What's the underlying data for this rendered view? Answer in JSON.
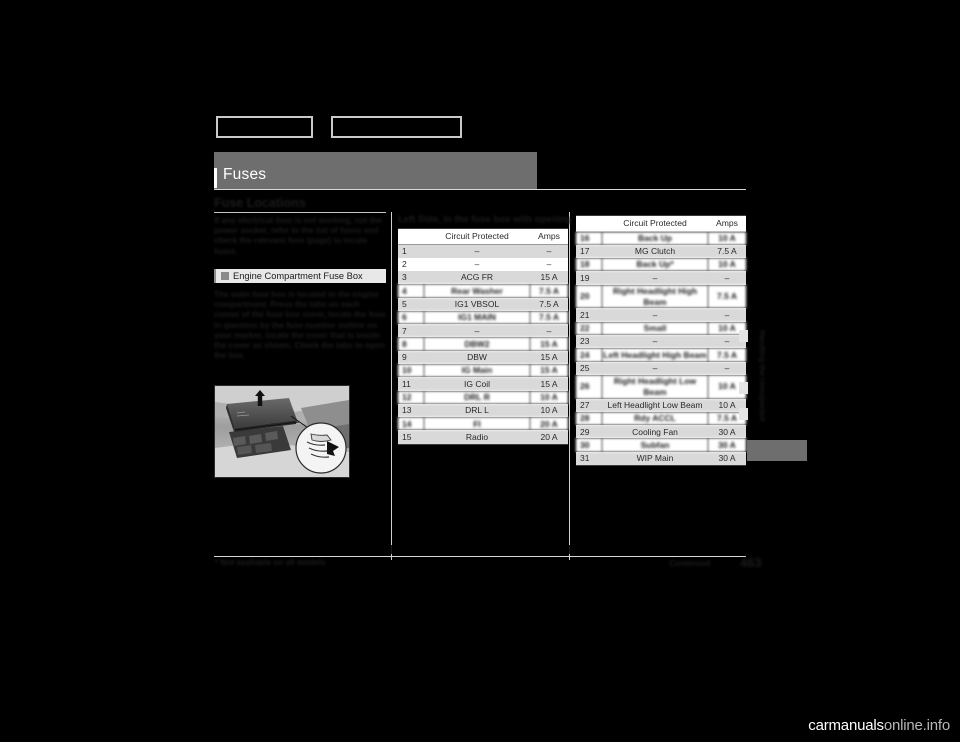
{
  "viewer": {
    "background_color": "#000000",
    "watermark": "carmanualsonline.info",
    "watermark_prefix": "carmanuals",
    "watermark_suffix": "online.info"
  },
  "topnav": {
    "prev_label": "",
    "next_label": ""
  },
  "chapter": {
    "title": "Fuses",
    "bar_color": "#6e6e6e"
  },
  "section": {
    "heading": "Fuse Locations"
  },
  "left_column": {
    "intro_paragraph": "If any electrical item is not working, not the power socket, refer to the list of fuses and check the relevant fuse (page) to locate fuses.",
    "subsection": {
      "swatch_color": "#8a8a8a",
      "title": "Engine Compartment Fuse Box"
    },
    "body_paragraph": "The main fuse box is located in the engine compartment. Press the tabs on each corner of the fuse box cover, locate the fuse in question by the fuse number outline on your marker, locate the cover that is inside the cover as shown. Check the tabs to open the box.",
    "illustration_name": "engine-compartment-fuse-box-photo"
  },
  "table_middle": {
    "caption": "Left Side, in the fuse box with opening",
    "headers": [
      "",
      "Circuit Protected",
      "Amps"
    ],
    "rows": [
      {
        "no": "1",
        "circuit": "–",
        "amps": "–",
        "shade": true,
        "obscured": false
      },
      {
        "no": "2",
        "circuit": "–",
        "amps": "–",
        "shade": false,
        "obscured": false
      },
      {
        "no": "3",
        "circuit": "ACG FR",
        "amps": "15 A",
        "shade": true,
        "obscured": false
      },
      {
        "no": "4",
        "circuit": "Rear Washer",
        "amps": "7.5 A",
        "shade": false,
        "obscured": true
      },
      {
        "no": "5",
        "circuit": "IG1 VBSOL",
        "amps": "7.5 A",
        "shade": true,
        "obscured": false
      },
      {
        "no": "6",
        "circuit": "IG1 MAIN",
        "amps": "7.5 A",
        "shade": false,
        "obscured": true
      },
      {
        "no": "7",
        "circuit": "–",
        "amps": "–",
        "shade": true,
        "obscured": false
      },
      {
        "no": "8",
        "circuit": "DBW2",
        "amps": "15 A",
        "shade": false,
        "obscured": true
      },
      {
        "no": "9",
        "circuit": "DBW",
        "amps": "15 A",
        "shade": true,
        "obscured": false
      },
      {
        "no": "10",
        "circuit": "IG Main",
        "amps": "15 A",
        "shade": false,
        "obscured": true
      },
      {
        "no": "11",
        "circuit": "IG Coil",
        "amps": "15 A",
        "shade": true,
        "obscured": false
      },
      {
        "no": "12",
        "circuit": "DRL R",
        "amps": "10 A",
        "shade": false,
        "obscured": true
      },
      {
        "no": "13",
        "circuit": "DRL L",
        "amps": "10 A",
        "shade": true,
        "obscured": false
      },
      {
        "no": "14",
        "circuit": "FI",
        "amps": "20 A",
        "shade": false,
        "obscured": true
      },
      {
        "no": "15",
        "circuit": "Radio",
        "amps": "20 A",
        "shade": true,
        "obscured": false
      }
    ]
  },
  "table_right": {
    "headers": [
      "",
      "Circuit Protected",
      "Amps"
    ],
    "rows": [
      {
        "no": "16",
        "circuit": "Back Up",
        "amps": "10 A",
        "shade": false,
        "obscured": true
      },
      {
        "no": "17",
        "circuit": "MG Clutch",
        "amps": "7.5 A",
        "shade": true,
        "obscured": false
      },
      {
        "no": "18",
        "circuit": "Back Up*",
        "amps": "10 A",
        "shade": false,
        "obscured": true
      },
      {
        "no": "19",
        "circuit": "–",
        "amps": "–",
        "shade": true,
        "obscured": false
      },
      {
        "no": "20",
        "circuit": "Right Headlight High Beam",
        "amps": "7.5 A",
        "shade": false,
        "obscured": true
      },
      {
        "no": "21",
        "circuit": "–",
        "amps": "–",
        "shade": true,
        "obscured": false
      },
      {
        "no": "22",
        "circuit": "Small",
        "amps": "10 A",
        "shade": false,
        "obscured": true
      },
      {
        "no": "23",
        "circuit": "–",
        "amps": "–",
        "shade": true,
        "obscured": false
      },
      {
        "no": "24",
        "circuit": "Left Headlight High Beam",
        "amps": "7.5 A",
        "shade": false,
        "obscured": true
      },
      {
        "no": "25",
        "circuit": "–",
        "amps": "–",
        "shade": true,
        "obscured": false
      },
      {
        "no": "26",
        "circuit": "Right Headlight Low Beam",
        "amps": "10 A",
        "shade": false,
        "obscured": true
      },
      {
        "no": "27",
        "circuit": "Left Headlight Low Beam",
        "amps": "10 A",
        "shade": true,
        "obscured": false
      },
      {
        "no": "28",
        "circuit": "Rdy ACCL",
        "amps": "7.5 A",
        "shade": false,
        "obscured": true
      },
      {
        "no": "29",
        "circuit": "Cooling Fan",
        "amps": "30 A",
        "shade": true,
        "obscured": false
      },
      {
        "no": "30",
        "circuit": "Subfan",
        "amps": "30 A",
        "shade": false,
        "obscured": true
      },
      {
        "no": "31",
        "circuit": "WIP Main",
        "amps": "30 A",
        "shade": true,
        "obscured": false
      }
    ]
  },
  "side_index": {
    "label": "Handling the Unexpected",
    "block_color": "#6e6e6e"
  },
  "footer": {
    "note": "* Not available on all models",
    "chapter_name": "Continued",
    "page_number": "463"
  }
}
